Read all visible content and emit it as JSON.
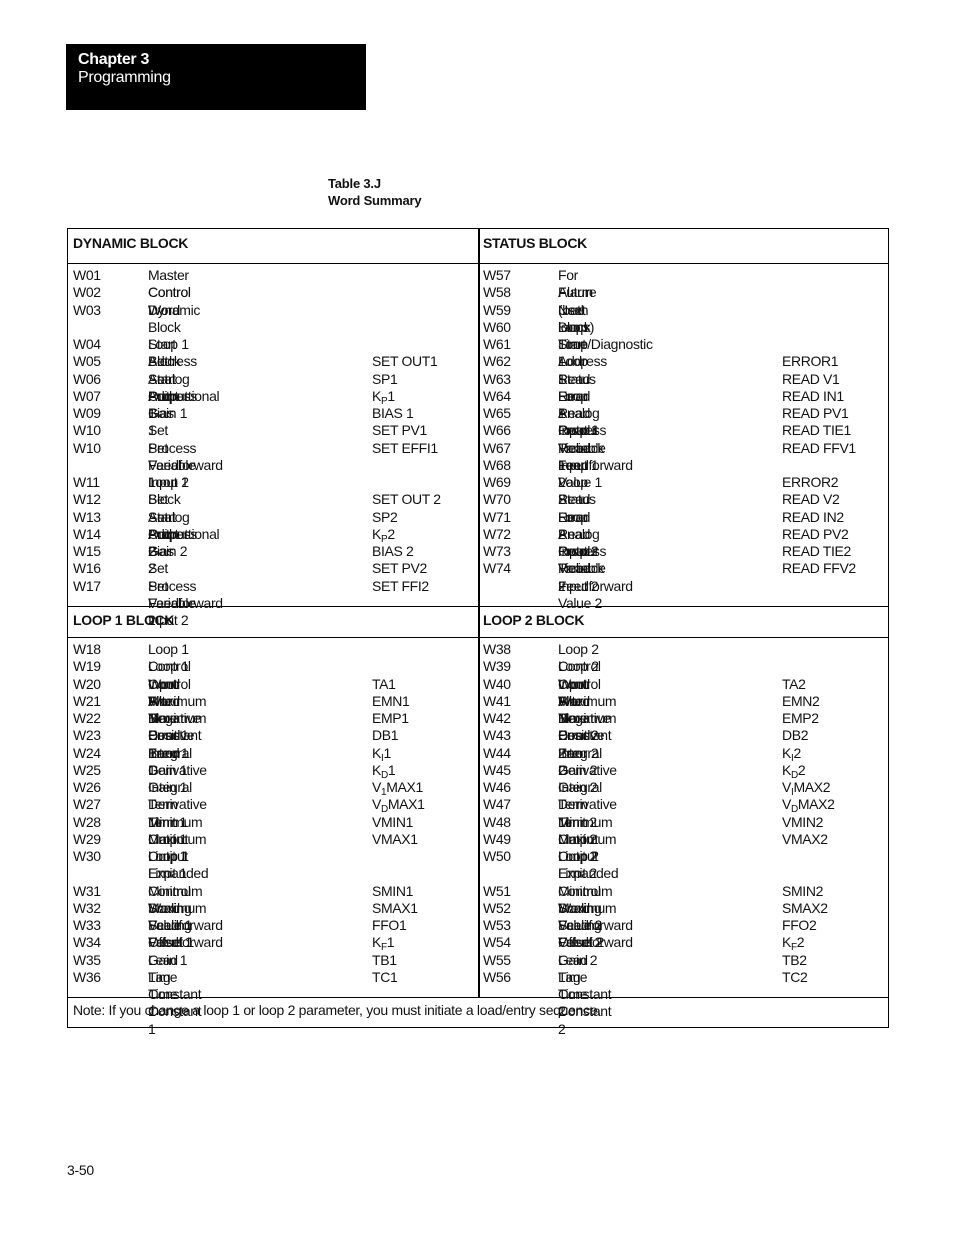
{
  "header": {
    "chapter": "Chapter 3",
    "section": "Programming"
  },
  "table": {
    "caption_line1": "Table 3.J",
    "caption_line2": "Word Summary",
    "dynamic": {
      "title": "DYNAMIC BLOCK",
      "rows": [
        [
          "W01",
          "Master Control Word",
          ""
        ],
        [
          "W02",
          "Control Word",
          ""
        ],
        [
          "W03",
          "Dynamic Block Start\nAddress",
          ""
        ],
        [
          "W04",
          "Loop 1 Block Start Address",
          ""
        ],
        [
          "W05",
          "Set Analog Output 1",
          "SET OUT1"
        ],
        [
          "W06",
          "Set Point 1",
          "SP1"
        ],
        [
          "W07",
          "Proportional Gain 1",
          {
            "b": "K",
            "s": "P",
            "r": "1"
          }
        ],
        [
          "W09",
          "Bias 1",
          "BIAS 1"
        ],
        [
          "W10",
          "Set Process Variable 1",
          "SET PV1"
        ],
        [
          "W10",
          "Set Feedforward Input 1",
          "SET EFFI1"
        ],
        [
          "",
          "",
          ""
        ],
        [
          "W11",
          "Loop 2 Block Start Address",
          ""
        ],
        [
          "W12",
          "Set Analog Output 2",
          "SET OUT 2"
        ],
        [
          "W13",
          "Set Point 2",
          "SP2"
        ],
        [
          "W14",
          "Proportional Gain 2",
          {
            "b": "K",
            "s": "P",
            "r": "2"
          }
        ],
        [
          "W15",
          "Bias 2",
          "BIAS 2"
        ],
        [
          "W16",
          "Set Process Variable 2",
          "SET PV2"
        ],
        [
          "W17",
          "Set Feedforward Input 2",
          "SET FFI2"
        ]
      ]
    },
    "status": {
      "title": "STATUS BLOCK",
      "rows": [
        [
          "W57",
          "For Future Use",
          ""
        ],
        [
          "W58",
          "Alarm (both loops)",
          ""
        ],
        [
          "W59",
          "Next Block Start Address",
          ""
        ],
        [
          "W60",
          "Loop Time/Diagnostic",
          ""
        ],
        [
          "W61",
          "Loop 1 Status",
          ""
        ],
        [
          "W62",
          "Loop 1 Error",
          "ERROR1"
        ],
        [
          "W63",
          "Read Loop 1 Output",
          "READ V1"
        ],
        [
          "W64",
          "Read Analog Input 1",
          "READ IN1"
        ],
        [
          "W65",
          "Read Process Variable 1",
          "READ PV1"
        ],
        [
          "W66",
          "Read Tieback Input 1",
          "READ TIE1"
        ],
        [
          "W67",
          "Read Feedforward Value 1",
          "READ FFV1"
        ],
        [
          "W68",
          "Loop 2 Status",
          ""
        ],
        [
          "W69",
          "Loop 2 Error",
          "ERROR2"
        ],
        [
          "W70",
          "Read Loop 2 Output",
          "READ V2"
        ],
        [
          "W71",
          "Read Analog Input 2",
          "READ IN2"
        ],
        [
          "W72",
          "Read Process Variable 2",
          "READ PV2"
        ],
        [
          "W73",
          "Read Tieback Input 2",
          "READ TIE2"
        ],
        [
          "W74",
          "Read Feedforward Value 2",
          "READ FFV2"
        ]
      ]
    },
    "loop1": {
      "title": "LOOP 1 BLOCK",
      "rows": [
        [
          "W18",
          "Loop 1 Control Word A",
          ""
        ],
        [
          "W19",
          "Loop 1 Control Word B",
          ""
        ],
        [
          "W20",
          "Input Filter Time Constant 1",
          "TA1"
        ],
        [
          "W21",
          "Maximum Negative Error 1",
          "EMN1"
        ],
        [
          "W22",
          "Maximum Positive Error 1",
          "EMP1"
        ],
        [
          "W23",
          "Dead Band 1",
          "DB1"
        ],
        [
          "W24",
          "Integral Gain 1",
          {
            "b": "K",
            "s": "I",
            "r": "1"
          }
        ],
        [
          "W25",
          "Derivative Gain 1",
          {
            "b": "K",
            "s": "D",
            "r": "1"
          }
        ],
        [
          "W26",
          "Integral Term Limit 1",
          {
            "b": "V",
            "s": "1",
            "r": "MAX1"
          }
        ],
        [
          "W27",
          "Derivative Term Limit 1",
          {
            "b": "V",
            "s": "D",
            "r": "MAX1"
          }
        ],
        [
          "W28",
          "Minimum Output Limit 1",
          "VMIN1"
        ],
        [
          "W29",
          "Maximum Output Limit 1",
          "VMAX1"
        ],
        [
          "W30",
          "Loop 1 Expanded Control\nWord",
          ""
        ],
        [
          "W31",
          "Minimum Scaling Value 1",
          "SMIN1"
        ],
        [
          "W32",
          "Maximum Scaling Value 1",
          "SMAX1"
        ],
        [
          "W33",
          "Feedforward Offset 1",
          "FFO1"
        ],
        [
          "W34",
          "Feedforward Gain 1",
          {
            "b": "K",
            "s": "F",
            "r": "1"
          }
        ],
        [
          "W35",
          "Lead Time Constant 1",
          "TB1"
        ],
        [
          "W36",
          "Lag Time Constant 1",
          "TC1"
        ]
      ]
    },
    "loop2": {
      "title": "LOOP 2 BLOCK",
      "rows": [
        [
          "W38",
          "Loop 2 Control Word A",
          ""
        ],
        [
          "W39",
          "Loop 2 Control Word B",
          ""
        ],
        [
          "W40",
          "Input Filter Time Constant 2",
          "TA2"
        ],
        [
          "W41",
          "Maximum Negative Error 2",
          "EMN2"
        ],
        [
          "W42",
          "Maximum Positive Error 2",
          "EMP2"
        ],
        [
          "W43",
          "Dead Ban 2",
          "DB2"
        ],
        [
          "W44",
          "Integral Gain 2",
          {
            "b": "K",
            "s": "I",
            "r": "2"
          }
        ],
        [
          "W45",
          "Derivative Gain 2",
          {
            "b": "K",
            "s": "D",
            "r": "2"
          }
        ],
        [
          "W46",
          "Integral Term Limit 2",
          {
            "b": "V",
            "s": "I",
            "r": "MAX2"
          }
        ],
        [
          "W47",
          "Derivative Term Limit 2",
          {
            "b": "V",
            "s": "D",
            "r": "MAX2"
          }
        ],
        [
          "W48",
          "Minimum Output Limit 2",
          "VMIN2"
        ],
        [
          "W49",
          "Maximum Output Limit 2",
          "VMAX2"
        ],
        [
          "W50",
          "Loop 2 Expanded Control\nWord",
          ""
        ],
        [
          "W51",
          "Minimum Scaling Value 2",
          "SMIN2"
        ],
        [
          "W52",
          "Maximum Scaling Value 2",
          "SMAX2"
        ],
        [
          "W53",
          "Feedforward Offset 2",
          "FFO2"
        ],
        [
          "W54",
          "Feedforward Gain 2",
          {
            "b": "K",
            "s": "F",
            "r": "2"
          }
        ],
        [
          "W55",
          "Lead Time Constant 2",
          "TB2"
        ],
        [
          "W56",
          "Lag Time Constant 2",
          "TC2"
        ]
      ]
    },
    "note": "Note:  If you change a loop 1 or loop 2 parameter, you must initiate a load/entry sequence."
  },
  "footer": {
    "page_number": "3-50"
  }
}
